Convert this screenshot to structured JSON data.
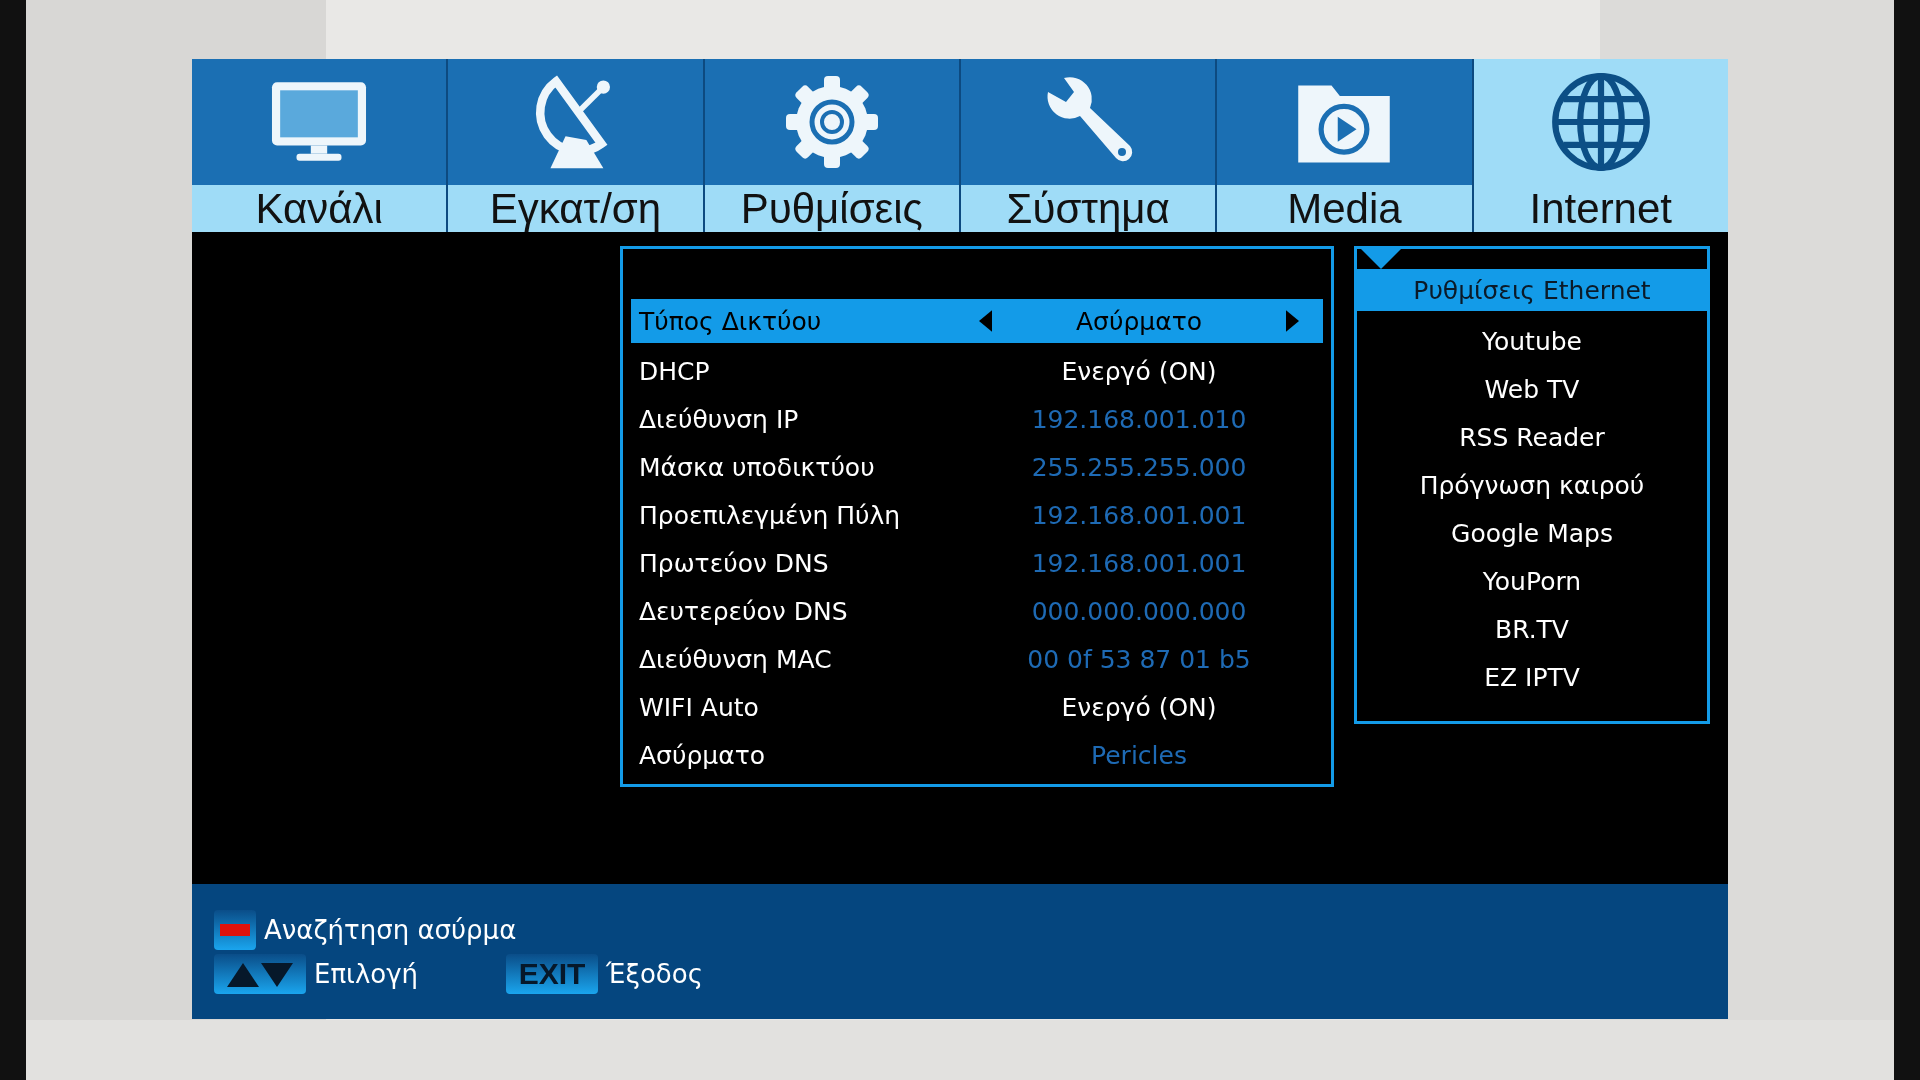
{
  "tabs": [
    {
      "label": "Κανάλι",
      "selected": false
    },
    {
      "label": "Εγκατ/ση",
      "selected": false
    },
    {
      "label": "Ρυθμίσεις",
      "selected": false
    },
    {
      "label": "Σύστημα",
      "selected": false
    },
    {
      "label": "Media",
      "selected": false
    },
    {
      "label": "Internet",
      "selected": true
    }
  ],
  "settings": [
    {
      "label": "Τύπος Δικτύου",
      "value": "Ασύρματο",
      "selected": true,
      "disabled": false
    },
    {
      "label": "DHCP",
      "value": "Ενεργό (ON)",
      "selected": false,
      "disabled": false
    },
    {
      "label": "Διεύθυνση IP",
      "value": "192.168.001.010",
      "selected": false,
      "disabled": true
    },
    {
      "label": "Μάσκα υποδικτύου",
      "value": "255.255.255.000",
      "selected": false,
      "disabled": true
    },
    {
      "label": "Προεπιλεγμένη Πύλη",
      "value": "192.168.001.001",
      "selected": false,
      "disabled": true
    },
    {
      "label": "Πρωτεύον DNS",
      "value": "192.168.001.001",
      "selected": false,
      "disabled": true
    },
    {
      "label": "Δευτερεύον DNS",
      "value": "000.000.000.000",
      "selected": false,
      "disabled": true
    },
    {
      "label": "Διεύθυνση MAC",
      "value": "00 0f 53 87 01 b5",
      "selected": false,
      "disabled": true
    },
    {
      "label": "WIFI Auto",
      "value": "Ενεργό (ON)",
      "selected": false,
      "disabled": false
    },
    {
      "label": "Ασύρματο",
      "value": "Pericles",
      "selected": false,
      "disabled": true
    }
  ],
  "internet_menu": [
    {
      "label": "Ρυθμίσεις Ethernet",
      "selected": true
    },
    {
      "label": "Youtube",
      "selected": false
    },
    {
      "label": "Web TV",
      "selected": false
    },
    {
      "label": "RSS Reader",
      "selected": false
    },
    {
      "label": "Πρόγνωση καιρού",
      "selected": false
    },
    {
      "label": "Google Maps",
      "selected": false
    },
    {
      "label": "YouPorn",
      "selected": false
    },
    {
      "label": "BR.TV",
      "selected": false
    },
    {
      "label": "EZ IPTV",
      "selected": false
    }
  ],
  "hints": [
    {
      "kind": "red",
      "label": "Αναζήτηση ασύρμα"
    },
    {
      "kind": "updown",
      "label": "Επιλογή"
    },
    {
      "kind": "exit",
      "key": "EXIT",
      "label": "Έξοδος"
    }
  ]
}
